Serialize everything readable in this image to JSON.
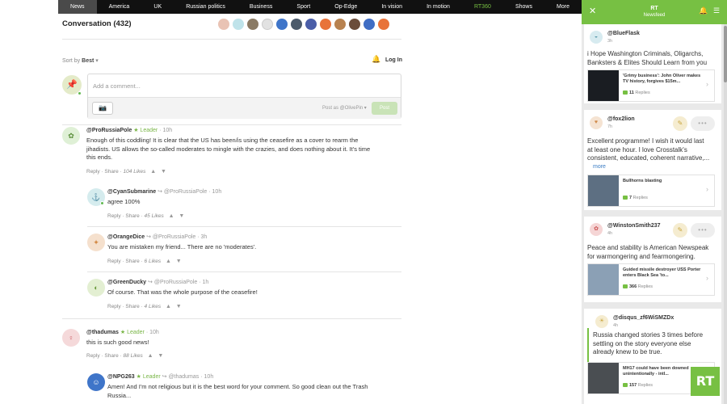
{
  "nav": {
    "items": [
      "News",
      "America",
      "UK",
      "Russian politics",
      "Business",
      "Sport",
      "Op-Edge",
      "In vision",
      "In motion",
      "RT360",
      "Shows",
      "More"
    ],
    "active": "News",
    "brand_item": "RT360"
  },
  "conversation": {
    "title": "Conversation (432)",
    "sort_label": "Sort by",
    "sort_value": "Best",
    "login": "Log In",
    "composer": {
      "placeholder": "Add a comment...",
      "post_as": "Post as @OlivePin",
      "post_button": "Post"
    }
  },
  "comments": [
    {
      "author": "@ProRussiaPole",
      "leader": "Leader",
      "reply_to": "",
      "time": "10h",
      "body": [
        "Enough of this coddling! It is clear that the US has been/is using the ceasefire as a cover to rearm the",
        "jihadists. US allows the so-called moderates to mingle with the crazies, and does nothing about it. It's time",
        "this ends."
      ],
      "reply": "Reply",
      "share": "Share",
      "likes": "104 Likes"
    },
    {
      "author": "@CyanSubmarine",
      "leader": "",
      "reply_to": "@ProRussiaPole",
      "time": "10h",
      "body": [
        "agree 100%"
      ],
      "reply": "Reply",
      "share": "Share",
      "likes": "45 Likes"
    },
    {
      "author": "@OrangeDice",
      "leader": "",
      "reply_to": "@ProRussiaPole",
      "time": "3h",
      "body": [
        " You are mistaken my friend... There are no 'moderates'."
      ],
      "reply": "Reply",
      "share": "Share",
      "likes": "6 Likes"
    },
    {
      "author": "@GreenDucky",
      "leader": "",
      "reply_to": "@ProRussiaPole",
      "time": "1h",
      "body": [
        "Of course. That was the whole purpose of the ceasefire!"
      ],
      "reply": "Reply",
      "share": "Share",
      "likes": "4 Likes"
    },
    {
      "author": "@thadumas",
      "leader": "Leader",
      "reply_to": "",
      "time": "10h",
      "body": [
        "this is such good news!"
      ],
      "reply": "Reply",
      "share": "Share",
      "likes": "88 Likes"
    },
    {
      "author": "@NPG263",
      "leader": "Leader",
      "reply_to": "@thadumas",
      "time": "10h",
      "body": [
        "Amen! And I'm not religious but it is the best word for your comment. So good clean out the Trash",
        "Russia..."
      ],
      "reply": "",
      "share": "",
      "likes": ""
    }
  ],
  "sidebar": {
    "title": "RT",
    "subtitle": "Newsfeed",
    "cards": [
      {
        "author": "@BlueFlask",
        "time": "3h",
        "text": [
          "i Hope Washington Criminals, Oligarchs,",
          "Banksters & Elites Should Learn from you"
        ],
        "link_title": "'Grimy business': John Oliver makes TV history, forgives $15m...",
        "replies_count": "11",
        "replies_label": "Replies"
      },
      {
        "author": "@fox2lion",
        "time": "7h",
        "text": [
          "Excellent programme! I wish it would last",
          "at least one hour. I love Crosstalk's",
          "consistent, educated, coherent narrative,..."
        ],
        "more": "more",
        "link_title": "Bullhorns blasting",
        "replies_count": "7",
        "replies_label": "Replies"
      },
      {
        "author": "@WinstonSmith237",
        "time": "4h",
        "text": [
          "Peace and stability is American Newspeak",
          "for warmongering and fearmongering."
        ],
        "link_title": "Guided missile destroyer USS Porter enters Black Sea 'to...",
        "replies_count": "366",
        "replies_label": "Replies"
      },
      {
        "author": "@disqus_zf6WiSMZDx",
        "time": "4h",
        "text": [
          "Russia changed stories 3 times before",
          "settling on the story everyone else",
          "already knew to be true."
        ],
        "link_title": "MH17 could have been downed unintentionally - intl...",
        "replies_count": "157",
        "replies_label": "Replies"
      }
    ],
    "logo_text": "RT"
  }
}
